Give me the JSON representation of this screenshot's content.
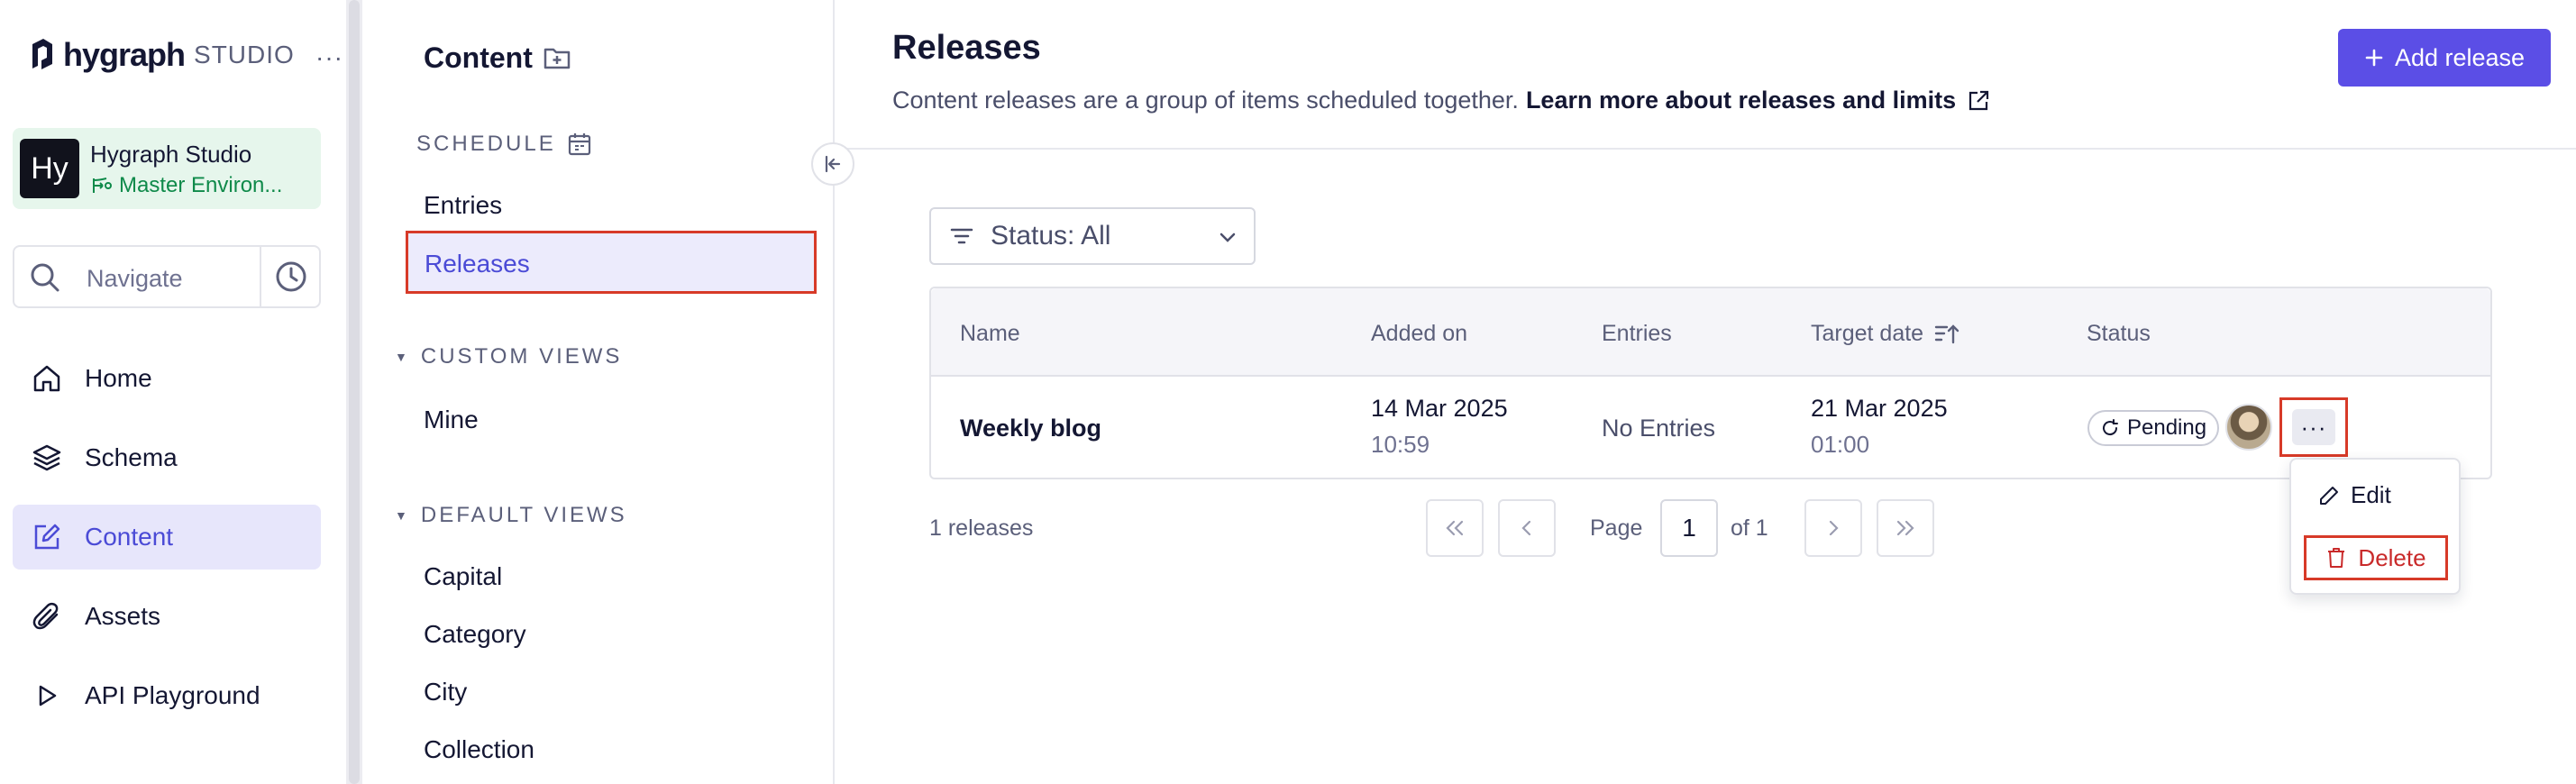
{
  "sidebar": {
    "logo_text": "hygraph",
    "logo_suffix": "STUDIO",
    "more": "···",
    "project": {
      "avatar": "Hy",
      "name": "Hygraph Studio",
      "environment": "Master Environ..."
    },
    "navigate_placeholder": "Navigate",
    "items": [
      {
        "label": "Home",
        "icon": "home-icon"
      },
      {
        "label": "Schema",
        "icon": "layers-icon"
      },
      {
        "label": "Content",
        "icon": "edit-square-icon",
        "active": true
      },
      {
        "label": "Assets",
        "icon": "paperclip-icon"
      },
      {
        "label": "API Playground",
        "icon": "play-icon"
      }
    ]
  },
  "content_panel": {
    "title": "Content",
    "schedule_heading": "SCHEDULE",
    "schedule_items": [
      "Entries",
      "Releases"
    ],
    "custom_views_heading": "CUSTOM VIEWS",
    "custom_views": [
      "Mine"
    ],
    "default_views_heading": "DEFAULT VIEWS",
    "default_views": [
      "Capital",
      "Category",
      "City",
      "Collection"
    ]
  },
  "main": {
    "title": "Releases",
    "description": "Content releases are a group of items scheduled together.",
    "learn_more": "Learn more about releases and limits",
    "add_release": "Add release",
    "filter_label": "Status: All",
    "table": {
      "columns": [
        "Name",
        "Added on",
        "Entries",
        "Target date",
        "Status"
      ],
      "rows": [
        {
          "name": "Weekly blog",
          "added_date": "14 Mar 2025",
          "added_time": "10:59",
          "entries": "No Entries",
          "target_date": "21 Mar 2025",
          "target_time": "01:00",
          "status": "Pending"
        }
      ]
    },
    "releases_count": "1 releases",
    "pagination": {
      "page_label": "Page",
      "current": "1",
      "of_label": "of 1"
    },
    "row_menu": {
      "edit": "Edit",
      "delete": "Delete"
    }
  },
  "colors": {
    "accent": "#5b4ee6",
    "highlight_border": "#d73a28",
    "env_green": "#0f8a4a"
  }
}
